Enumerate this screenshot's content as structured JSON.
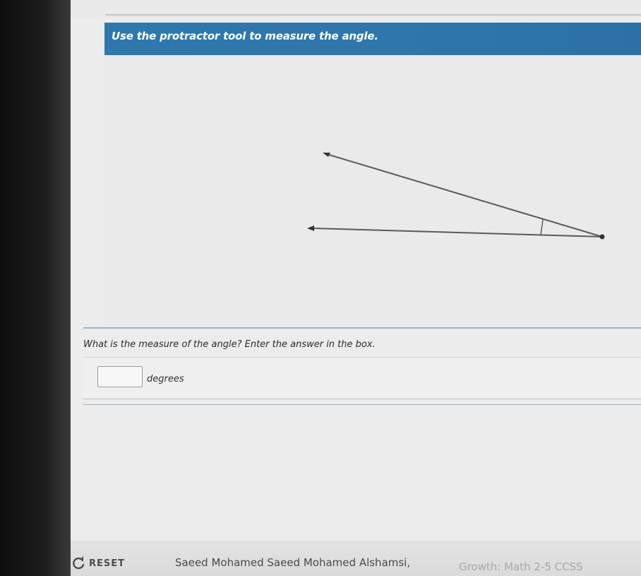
{
  "header": {
    "instruction": "Use the protractor tool to measure the angle."
  },
  "question": {
    "prompt": "What is the measure of the angle? Enter the answer in the box.",
    "answer_value": "",
    "unit_label": "degrees"
  },
  "footer": {
    "reset_label": "RESET",
    "student_name": "Saeed Mohamed Saeed Mohamed Alshamsi,",
    "course_label": "Growth: Math 2-5 CCSS"
  },
  "colors": {
    "header_bg": "#2f78ad",
    "divider": "#9fb3c2"
  },
  "icons": {
    "reset": "refresh-icon"
  }
}
